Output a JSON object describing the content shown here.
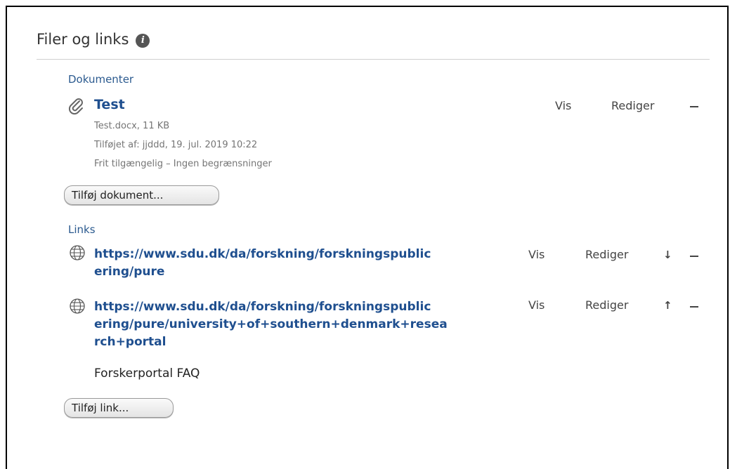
{
  "panel": {
    "title": "Filer og links",
    "info_icon": "info-icon"
  },
  "documents": {
    "section_label": "Dokumenter",
    "items": [
      {
        "icon": "paperclip-icon",
        "title": "Test",
        "file": "Test.docx, 11 KB",
        "added": "Tilføjet af: jjddd, 19. jul. 2019 10:22",
        "access": "Frit tilgængelig – Ingen begrænsninger",
        "view_label": "Vis",
        "edit_label": "Rediger"
      }
    ],
    "add_button": "Tilføj dokument..."
  },
  "links": {
    "section_label": "Links",
    "items": [
      {
        "icon": "globe-icon",
        "url_line1": "https://www.sdu.dk/da/forskning/forskningspublic",
        "url_line2": "ering/pure",
        "view_label": "Vis",
        "edit_label": "Rediger",
        "move": "down"
      },
      {
        "icon": "globe-icon",
        "url_line1": "https://www.sdu.dk/da/forskning/forskningspublic",
        "url_line2": "ering/pure/university+of+southern+denmark+resea",
        "url_line3": "rch+portal",
        "description": "Forskerportal FAQ",
        "view_label": "Vis",
        "edit_label": "Rediger",
        "move": "up"
      }
    ],
    "add_button": "Tilføj link..."
  }
}
